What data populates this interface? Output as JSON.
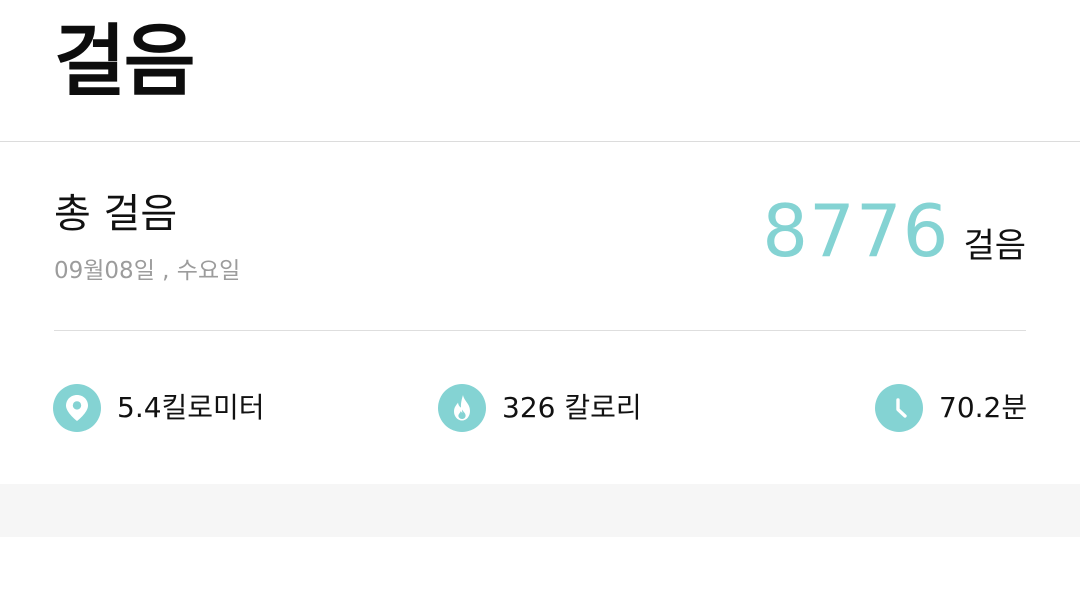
{
  "header": {
    "title": "걸음"
  },
  "summary": {
    "label": "총 걸음",
    "date": "09월08일 , 수요일",
    "steps": "8776",
    "steps_unit": "걸음"
  },
  "metrics": [
    {
      "icon": "location-pin-icon",
      "value": "5.4킬로미터"
    },
    {
      "icon": "flame-icon",
      "value": "326 칼로리"
    },
    {
      "icon": "clock-icon",
      "value": "70.2분"
    }
  ],
  "colors": {
    "accent": "#84d3d3",
    "date_text": "#9c9c9c",
    "divider": "#dedede",
    "bottom_band": "#f6f6f6"
  }
}
